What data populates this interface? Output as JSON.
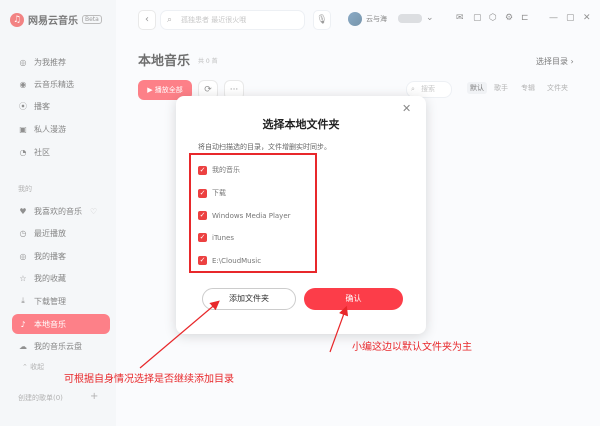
{
  "app": {
    "name": "网易云音乐",
    "badge": "Beta",
    "logo_icon": "netease-logo"
  },
  "sidebar": {
    "items": [
      {
        "label": "为我推荐",
        "icon": "recommend-icon",
        "glyph": "◎"
      },
      {
        "label": "云音乐精选",
        "icon": "disc-icon",
        "glyph": "◉"
      },
      {
        "label": "播客",
        "icon": "podcast-icon",
        "glyph": "((·))"
      },
      {
        "label": "私人漫游",
        "icon": "roam-icon",
        "glyph": "▣"
      },
      {
        "label": "社区",
        "icon": "community-icon",
        "glyph": "◔"
      }
    ],
    "my_label": "我的",
    "my_items": [
      {
        "label": "我喜欢的音乐",
        "icon": "heart-icon",
        "glyph": "♥"
      },
      {
        "label": "最近播放",
        "icon": "clock-icon",
        "glyph": "◷"
      },
      {
        "label": "我的播客",
        "icon": "podcast-icon",
        "glyph": "◎"
      },
      {
        "label": "我的收藏",
        "icon": "star-icon",
        "glyph": "☆"
      },
      {
        "label": "下载管理",
        "icon": "download-icon",
        "glyph": "⤓"
      },
      {
        "label": "本地音乐",
        "icon": "music-icon",
        "glyph": "♪"
      },
      {
        "label": "我的音乐云盘",
        "icon": "cloud-icon",
        "glyph": "☁"
      }
    ],
    "collapse_label": "收起",
    "created_playlists_label": "创建的歌单(0)"
  },
  "topbar": {
    "search_placeholder": "孤独患者 最近很火哦",
    "username": "云与海"
  },
  "main": {
    "title": "本地音乐",
    "count": "共 0 首",
    "select_dir": "选择目录 ›",
    "play_all": "▶ 播放全部",
    "local_search_placeholder": "搜索",
    "sort_tabs": [
      "默认",
      "歌手",
      "专辑",
      "文件夹"
    ]
  },
  "modal": {
    "title": "选择本地文件夹",
    "description": "将自动扫描选的目录，文件增删实时同步。",
    "folders": [
      "我的音乐",
      "下载",
      "Windows Media Player",
      "iTunes",
      "E:\\CloudMusic"
    ],
    "add_folder_label": "添加文件夹",
    "confirm_label": "确认"
  },
  "annotations": {
    "left": "可根据自身情况选择是否继续添加目录",
    "right": "小编这边以默认文件夹为主"
  },
  "colors": {
    "brand_red": "#fc3d49",
    "annot_red": "#e8282b"
  }
}
